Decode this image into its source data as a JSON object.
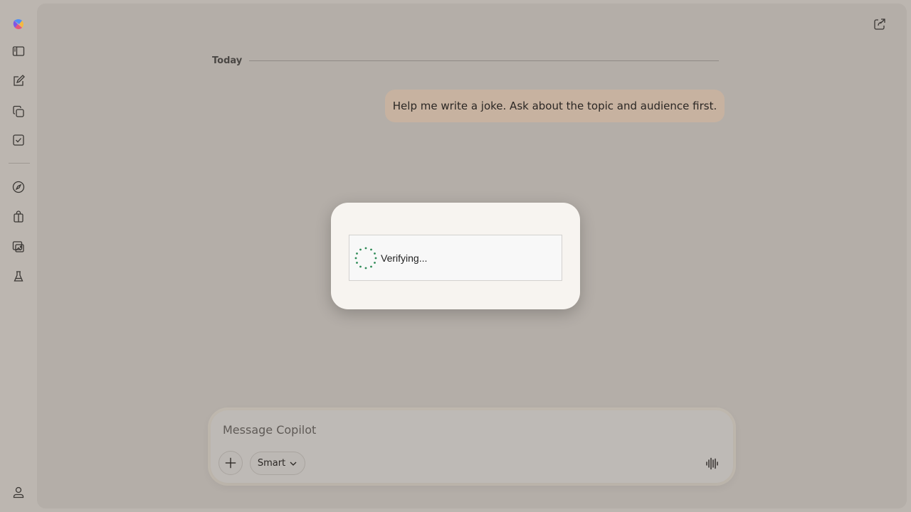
{
  "sidebar": {
    "logo_icon": "copilot-logo",
    "items": [
      {
        "icon": "sidebar-toggle-icon"
      },
      {
        "icon": "new-chat-icon"
      },
      {
        "icon": "pages-icon"
      },
      {
        "icon": "tasks-icon"
      },
      {
        "icon": "discover-icon"
      },
      {
        "icon": "shopping-icon"
      },
      {
        "icon": "imagine-icon"
      },
      {
        "icon": "labs-icon"
      }
    ],
    "profile_icon": "profile-icon"
  },
  "header": {
    "share_icon": "share-icon"
  },
  "conversation": {
    "date_label": "Today",
    "user_message": "Help me write a joke. Ask about the topic and audience first."
  },
  "verification": {
    "status": "Verifying..."
  },
  "composer": {
    "placeholder": "Message Copilot",
    "mode_label": "Smart",
    "voice_icon": "voice-icon"
  },
  "colors": {
    "background": "#bcb6b0",
    "user_bubble": "#c7b2a0",
    "modal": "#f7f4f0",
    "spinner": "#2e8b57"
  }
}
